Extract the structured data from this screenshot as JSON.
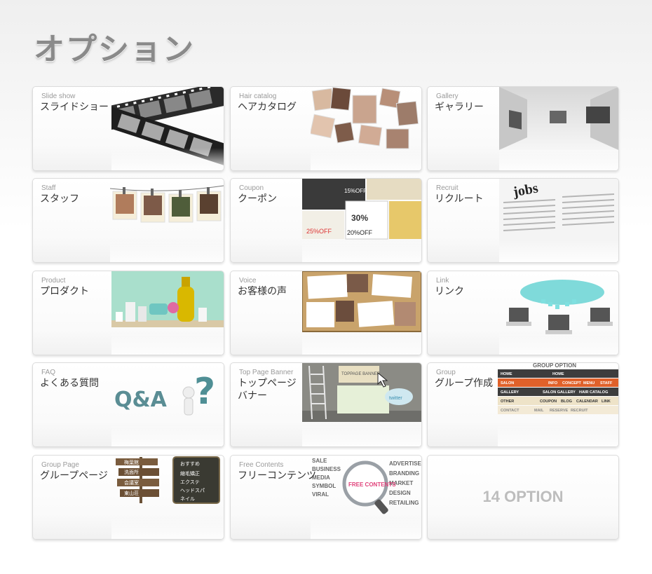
{
  "page": {
    "title": "オプション"
  },
  "cards": [
    {
      "en": "Slide show",
      "jp": "スライドショー"
    },
    {
      "en": "Hair catalog",
      "jp": "ヘアカタログ"
    },
    {
      "en": "Gallery",
      "jp": "ギャラリー"
    },
    {
      "en": "Staff",
      "jp": "スタッフ"
    },
    {
      "en": "Coupon",
      "jp": "クーポン"
    },
    {
      "en": "Recruit",
      "jp": "リクルート"
    },
    {
      "en": "Product",
      "jp": "プロダクト"
    },
    {
      "en": "Voice",
      "jp": "お客様の声"
    },
    {
      "en": "Link",
      "jp": "リンク"
    },
    {
      "en": "FAQ",
      "jp": "よくある質問"
    },
    {
      "en": "Top Page Banner",
      "jp": "トップページ\nバナー"
    },
    {
      "en": "Group",
      "jp": "グループ作成"
    },
    {
      "en": "Group Page",
      "jp": "グループページ"
    },
    {
      "en": "Free Contents",
      "jp": "フリーコンテンツ"
    }
  ],
  "summary": {
    "label": "14 OPTION"
  },
  "thumb_text": {
    "recruit_word": "jobs",
    "faq_word": "Q&A",
    "faq_mark": "?",
    "coupon_pct1": "30%",
    "coupon_pct2": "15%OFF",
    "coupon_pct3": "25%OFF",
    "coupon_pct4": "20%OFF",
    "banner_label": "TOPPAGE BANNER",
    "banner_twitter": "twitter",
    "group_title": "GROUP OPTION",
    "group_rows": [
      [
        "HOME",
        "HOME",
        "",
        "",
        ""
      ],
      [
        "SALON",
        "INFO",
        "CONCEPT",
        "MENU",
        "STAFF"
      ],
      [
        "GALLERY",
        "SALON GALLERY",
        "HAIR CATALOG",
        "",
        ""
      ],
      [
        "OTHER",
        "COUPON",
        "BLOG",
        "CALENDAR",
        "LINK"
      ],
      [
        "CONTACT",
        "MAIL",
        "RESERVE",
        "RECRUIT",
        ""
      ]
    ],
    "free_badge": "FREE CONTENTS",
    "free_words": [
      "SALE",
      "BUSINESS",
      "MEDIA",
      "SYMBOL",
      "VIRAL",
      "ADVERTISE",
      "BRANDING",
      "MARKET",
      "DESIGN",
      "RETAILING"
    ],
    "sign_words": [
      "洗面所",
      "会議室",
      "東山荘",
      "梅葉館",
      "おすすめ",
      "縮毛矯正",
      "エクステ",
      "ヘッドスパ",
      "ネイル"
    ]
  },
  "colors": {
    "accent_orange": "#e0612a",
    "nav_dark": "#3d3d3d",
    "cork": "#c9a36b",
    "mint": "#a9dfcc",
    "title_gray": "#8a8a8a"
  }
}
